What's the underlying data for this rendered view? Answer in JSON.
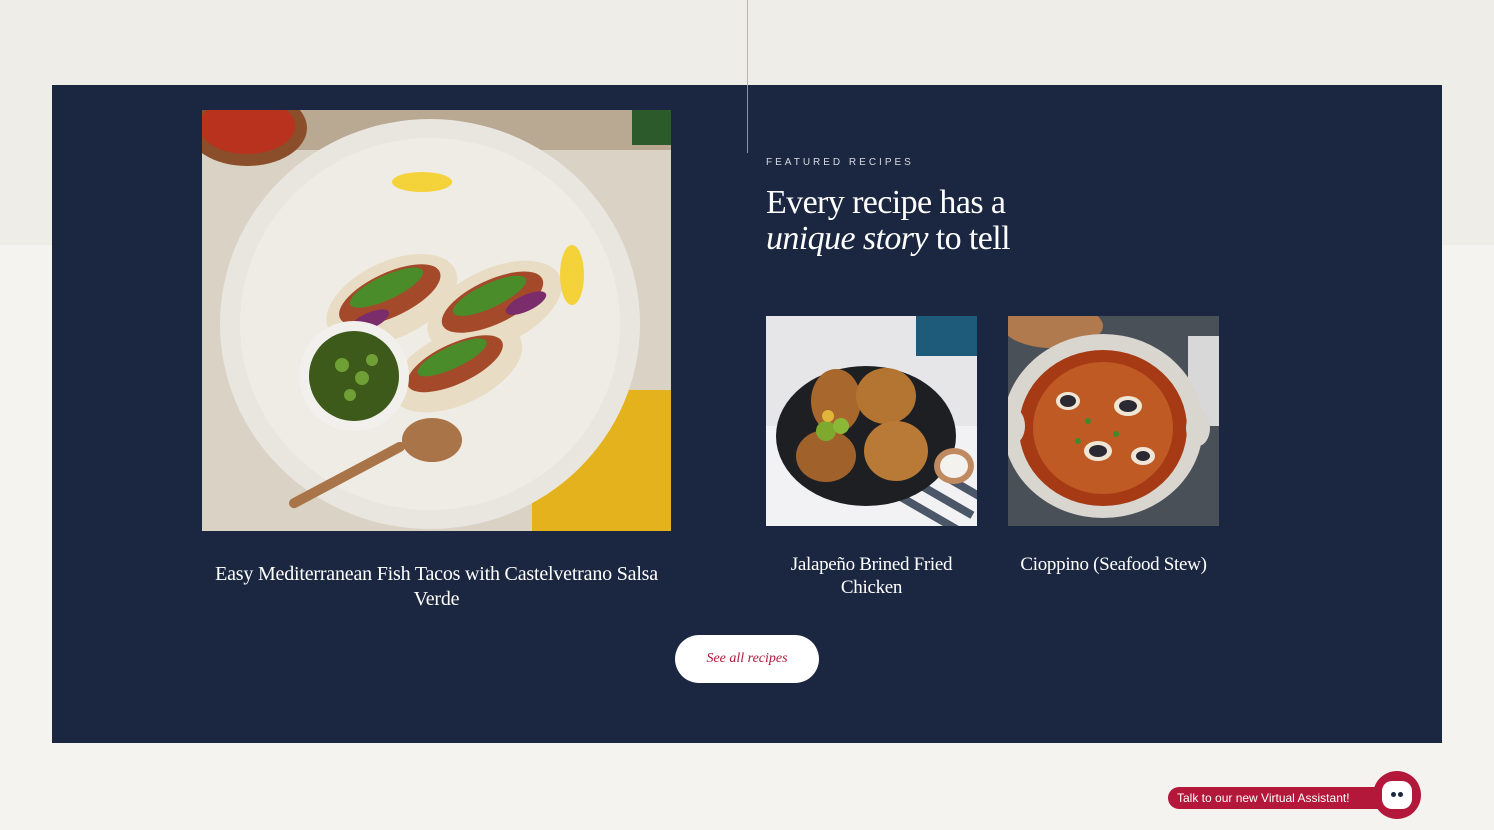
{
  "featured": {
    "eyebrow": "FEATURED RECIPES",
    "headline_line1": "Every recipe has a",
    "headline_italic": "unique story",
    "headline_rest": " to tell"
  },
  "recipes": [
    {
      "title": "Easy Mediterranean Fish Tacos with Castelvetrano Salsa Verde",
      "image": "fish-tacos-photo"
    },
    {
      "title": "Jalapeño Brined Fried Chicken",
      "image": "fried-chicken-photo"
    },
    {
      "title": "Cioppino (Seafood Stew)",
      "image": "cioppino-photo"
    }
  ],
  "cta": {
    "label": "See all recipes"
  },
  "assistant": {
    "label": "Talk to our new Virtual Assistant!",
    "icon": "chat-bot-icon"
  },
  "colors": {
    "page_bg": "#f5f3ef",
    "panel_bg": "#1b2740",
    "accent": "#b3173a",
    "text_light": "#ffffff"
  }
}
